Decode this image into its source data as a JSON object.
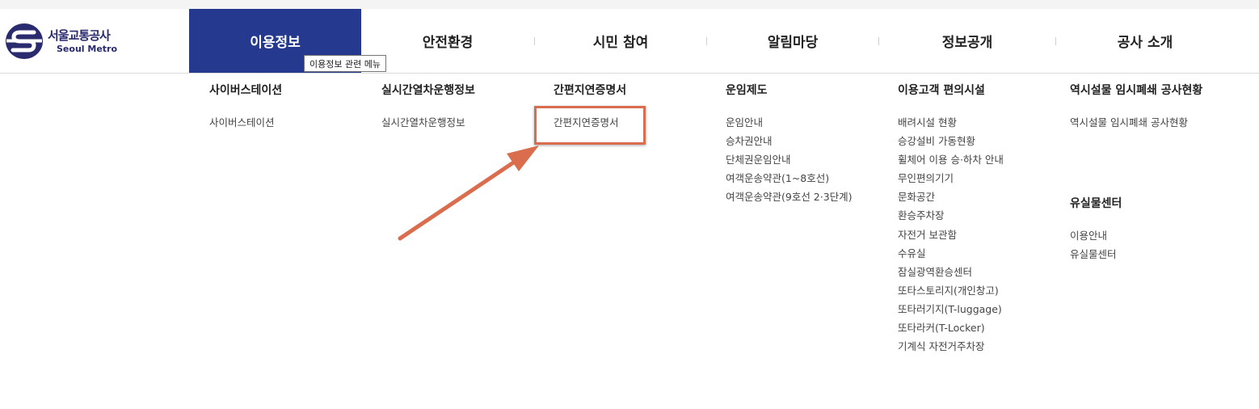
{
  "logo": {
    "name_ko": "서울교통공사",
    "name_en": "Seoul Metro"
  },
  "gnb": [
    {
      "label": "이용정보"
    },
    {
      "label": "안전환경"
    },
    {
      "label": "시민 참여"
    },
    {
      "label": "알림마당"
    },
    {
      "label": "정보공개"
    },
    {
      "label": "공사 소개"
    }
  ],
  "tooltip": "이용정보 관련 메뉴",
  "columns": [
    {
      "title": "사이버스테이션",
      "items": [
        "사이버스테이션"
      ]
    },
    {
      "title": "실시간열차운행정보",
      "items": [
        "실시간열차운행정보"
      ]
    },
    {
      "title": "간편지연증명서",
      "items": [
        "간편지연증명서"
      ]
    },
    {
      "title": "운임제도",
      "items": [
        "운임안내",
        "승차권안내",
        "단체권운임안내",
        "여객운송약관(1~8호선)",
        "여객운송약관(9호선 2·3단계)"
      ]
    },
    {
      "title": "이용고객 편의시설",
      "items": [
        "배려시설 현황",
        "승강설비 가동현황",
        "휠체어 이용 승·하차 안내",
        "무인편의기기",
        "문화공간",
        "환승주차장",
        "자전거 보관함",
        "수유실",
        "잠실광역환승센터",
        "또타스토리지(개인창고)",
        "또타러기지(T-luggage)",
        "또타라커(T-Locker)",
        "기계식 자전거주차장"
      ]
    },
    {
      "title": "역시설물 임시폐쇄 공사현황",
      "items": [
        "역시설물 임시폐쇄 공사현황"
      ]
    },
    {
      "title": "유실물센터",
      "items": [
        "이용안내",
        "유실물센터"
      ]
    }
  ],
  "colors": {
    "active_tab_bg": "#253a8e",
    "highlight": "#d96d4e",
    "logo_blue": "#2a2a6e"
  }
}
